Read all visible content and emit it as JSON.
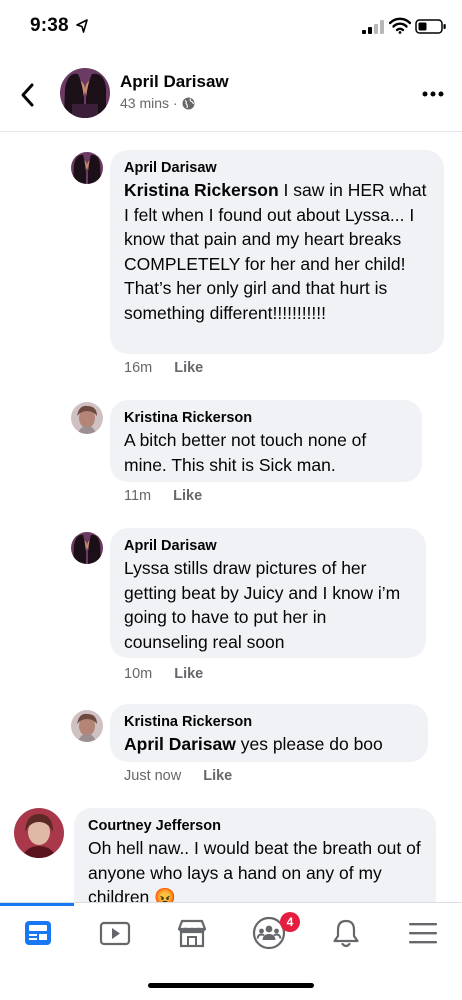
{
  "status": {
    "time": "9:38"
  },
  "header": {
    "name": "April Darisaw",
    "meta": "43 mins ·"
  },
  "comments": [
    {
      "author": "April Darisaw",
      "mention": "Kristina Rickerson",
      "text": " I saw in HER what I felt when I found out about Lyssa... I know that pain and my heart breaks COMPLETELY for her and her child! That’s her only girl and that hurt is something different!!!!!!!!!!!",
      "time": "16m",
      "like": "Like"
    },
    {
      "author": "Kristina Rickerson",
      "mention": "",
      "text": "A bitch better not touch none of mine. This shit is Sick  man.",
      "time": "11m",
      "like": "Like"
    },
    {
      "author": "April Darisaw",
      "mention": "",
      "text": "Lyssa stills draw pictures of her getting beat by Juicy and I know i’m going to have to put her in counseling real soon",
      "time": "10m",
      "like": "Like"
    },
    {
      "author": "Kristina Rickerson",
      "mention": "April Darisaw",
      "text": " yes please do boo",
      "time": "Just now",
      "like": "Like"
    },
    {
      "author": "Courtney Jefferson",
      "mention": "",
      "text": "Oh hell naw.. I would beat the breath out of anyone who lays a hand on any of my children 😡",
      "time": "",
      "like": ""
    }
  ],
  "tabbar": {
    "notification_badge": "4"
  },
  "icons": [
    "location-arrow-icon",
    "signal-icon",
    "wifi-icon",
    "battery-icon",
    "back-icon",
    "globe-icon",
    "more-icon",
    "news-feed-icon",
    "watch-icon",
    "marketplace-icon",
    "groups-icon",
    "bell-icon",
    "menu-icon"
  ]
}
